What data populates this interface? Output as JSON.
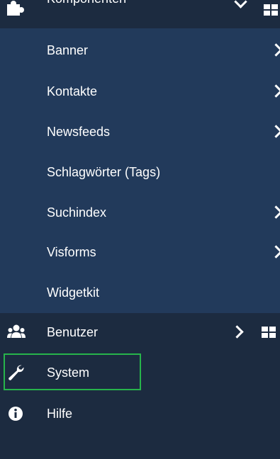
{
  "top": {
    "label": "Komponenten",
    "icon": "puzzle-icon"
  },
  "submenu": [
    {
      "label": "Banner",
      "has_chevron": true
    },
    {
      "label": "Kontakte",
      "has_chevron": true
    },
    {
      "label": "Newsfeeds",
      "has_chevron": true
    },
    {
      "label": "Schlagwörter (Tags)",
      "has_chevron": false
    },
    {
      "label": "Suchindex",
      "has_chevron": true
    },
    {
      "label": "Visforms",
      "has_chevron": true
    },
    {
      "label": "Widgetkit",
      "has_chevron": false
    }
  ],
  "main": [
    {
      "label": "Benutzer",
      "icon": "users-icon",
      "has_chevron": true,
      "has_grid": true
    },
    {
      "label": "System",
      "icon": "wrench-icon",
      "has_chevron": false,
      "has_grid": false,
      "highlighted": true
    },
    {
      "label": "Hilfe",
      "icon": "info-icon",
      "has_chevron": false,
      "has_grid": false
    }
  ],
  "colors": {
    "sidebar_bg": "#1c2b40",
    "submenu_bg": "#223a5b",
    "highlight_border": "#27b44b",
    "text": "#ffffff"
  }
}
